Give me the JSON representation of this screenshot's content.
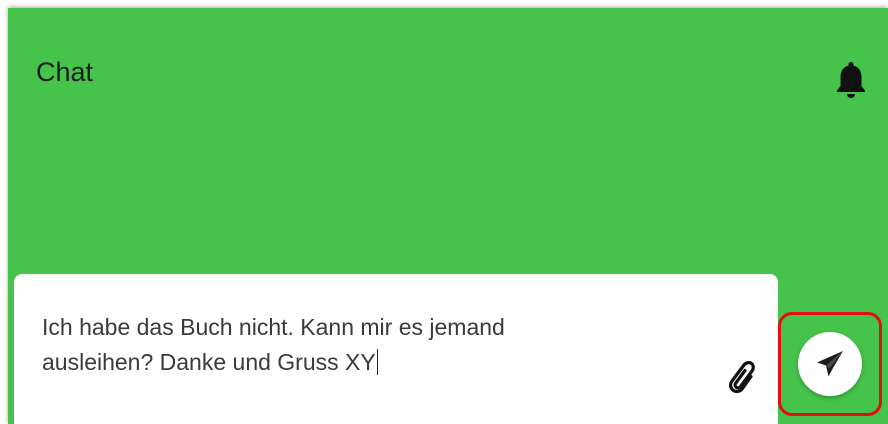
{
  "header": {
    "title": "Chat",
    "notification_icon": "bell-icon"
  },
  "composer": {
    "message": "Ich habe das Buch nicht. Kann mir es jemand\nausleihen? Danke und Gruss XY",
    "attach_icon": "paperclip-icon",
    "send_icon": "paper-plane-icon"
  },
  "colors": {
    "background": "#46c34a",
    "highlight": "#e10f14"
  }
}
